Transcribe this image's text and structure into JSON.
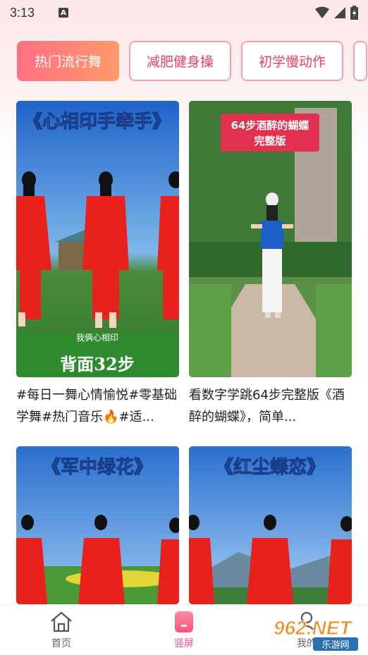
{
  "status_bar": {
    "time": "3:13",
    "notification_badge": "A"
  },
  "tabs": [
    {
      "label": "热门流行舞",
      "active": true
    },
    {
      "label": "减肥健身操",
      "active": false
    },
    {
      "label": "初学慢动作",
      "active": false
    }
  ],
  "feed": [
    {
      "title_overlay": "《心相印手牵手》",
      "subtitle_overlay": "我俩心相印",
      "bottom_overlay": "背面32步",
      "caption": "#每日一舞心情愉悦#零基础学舞#热门音乐🔥#适..."
    },
    {
      "title_overlay": "64步酒醉的蝴蝶",
      "title_overlay_line2": "完整版",
      "caption": "看数字学跳64步完整版《酒醉的蝴蝶》，简单..."
    },
    {
      "title_overlay": "《军中绿花》"
    },
    {
      "title_overlay": "《红尘蝶恋》"
    }
  ],
  "bottom_nav": [
    {
      "label": "首页",
      "icon": "home-icon",
      "active": false
    },
    {
      "label": "竖屏",
      "icon": "vertical-video-icon",
      "active": true
    },
    {
      "label": "我的",
      "icon": "profile-icon",
      "active": false
    }
  ],
  "watermark": {
    "main": "962.NET",
    "sub": "乐游网"
  },
  "colors": {
    "accent": "#ff5a78",
    "tab_border": "#f7a0ab",
    "tab_text": "#ea3f63"
  }
}
